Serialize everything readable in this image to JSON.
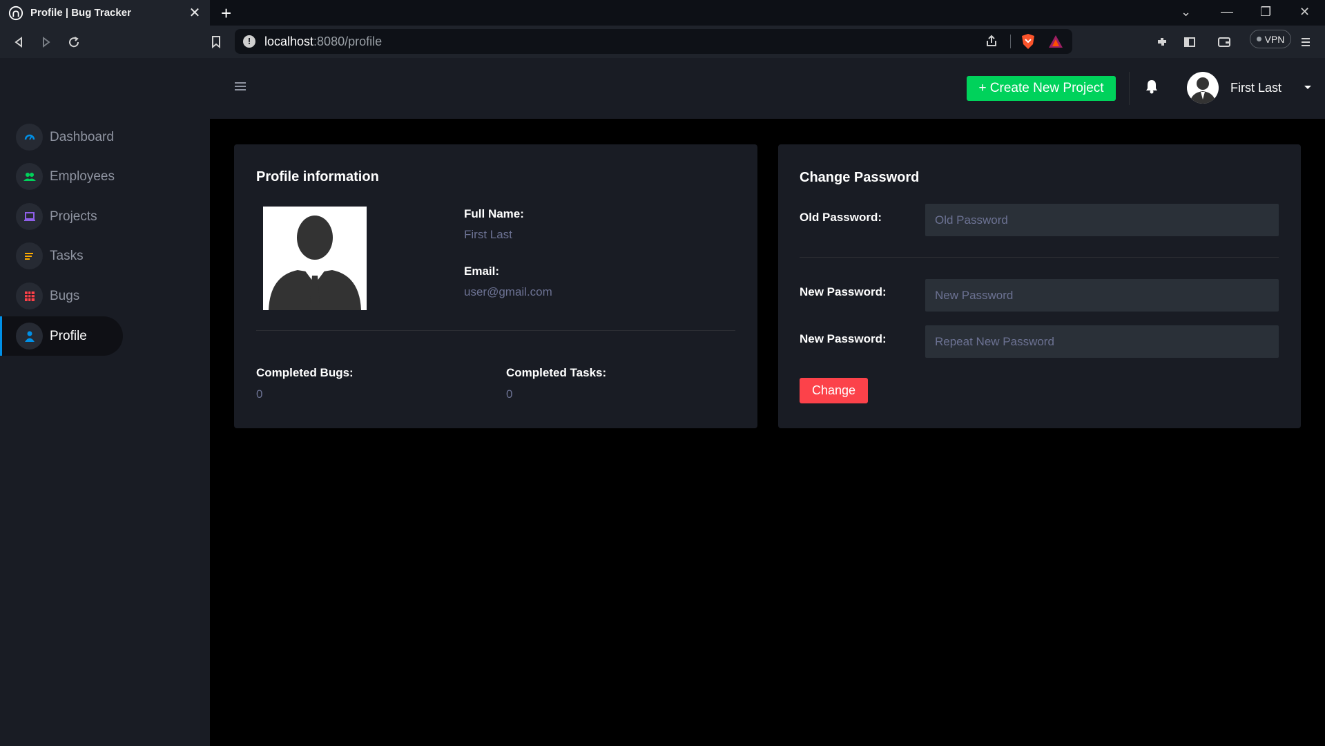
{
  "browser": {
    "tab_title": "Profile | Bug Tracker",
    "url_host": "localhost",
    "url_path": ":8080/profile",
    "vpn_label": "VPN"
  },
  "sidebar": {
    "items": [
      {
        "label": "Dashboard",
        "icon": "speedometer-icon",
        "color": "#0090e7",
        "active": false
      },
      {
        "label": "Employees",
        "icon": "people-icon",
        "color": "#00d25b",
        "active": false
      },
      {
        "label": "Projects",
        "icon": "laptop-icon",
        "color": "#8f5fe8",
        "active": false
      },
      {
        "label": "Tasks",
        "icon": "list-icon",
        "color": "#ffab00",
        "active": false
      },
      {
        "label": "Bugs",
        "icon": "table-icon",
        "color": "#fc424a",
        "active": false
      },
      {
        "label": "Profile",
        "icon": "person-icon",
        "color": "#0090e7",
        "active": true
      }
    ]
  },
  "topnav": {
    "create_label": "+ Create New Project",
    "user_name": "First Last"
  },
  "profile_card": {
    "title": "Profile information",
    "full_name_label": "Full Name:",
    "full_name_value": "First Last",
    "email_label": "Email:",
    "email_value": "user@gmail.com",
    "completed_bugs_label": "Completed Bugs:",
    "completed_bugs_value": "0",
    "completed_tasks_label": "Completed Tasks:",
    "completed_tasks_value": "0"
  },
  "password_card": {
    "title": "Change Password",
    "old_label": "Old Password:",
    "old_placeholder": "Old Password",
    "new_label": "New Password:",
    "new_placeholder": "New Password",
    "repeat_label": "New Password:",
    "repeat_placeholder": "Repeat New Password",
    "change_label": "Change"
  },
  "colors": {
    "accent_green": "#00d25b",
    "accent_red": "#fc424a",
    "accent_blue": "#0090e7",
    "sidebar_bg": "#191c24"
  }
}
